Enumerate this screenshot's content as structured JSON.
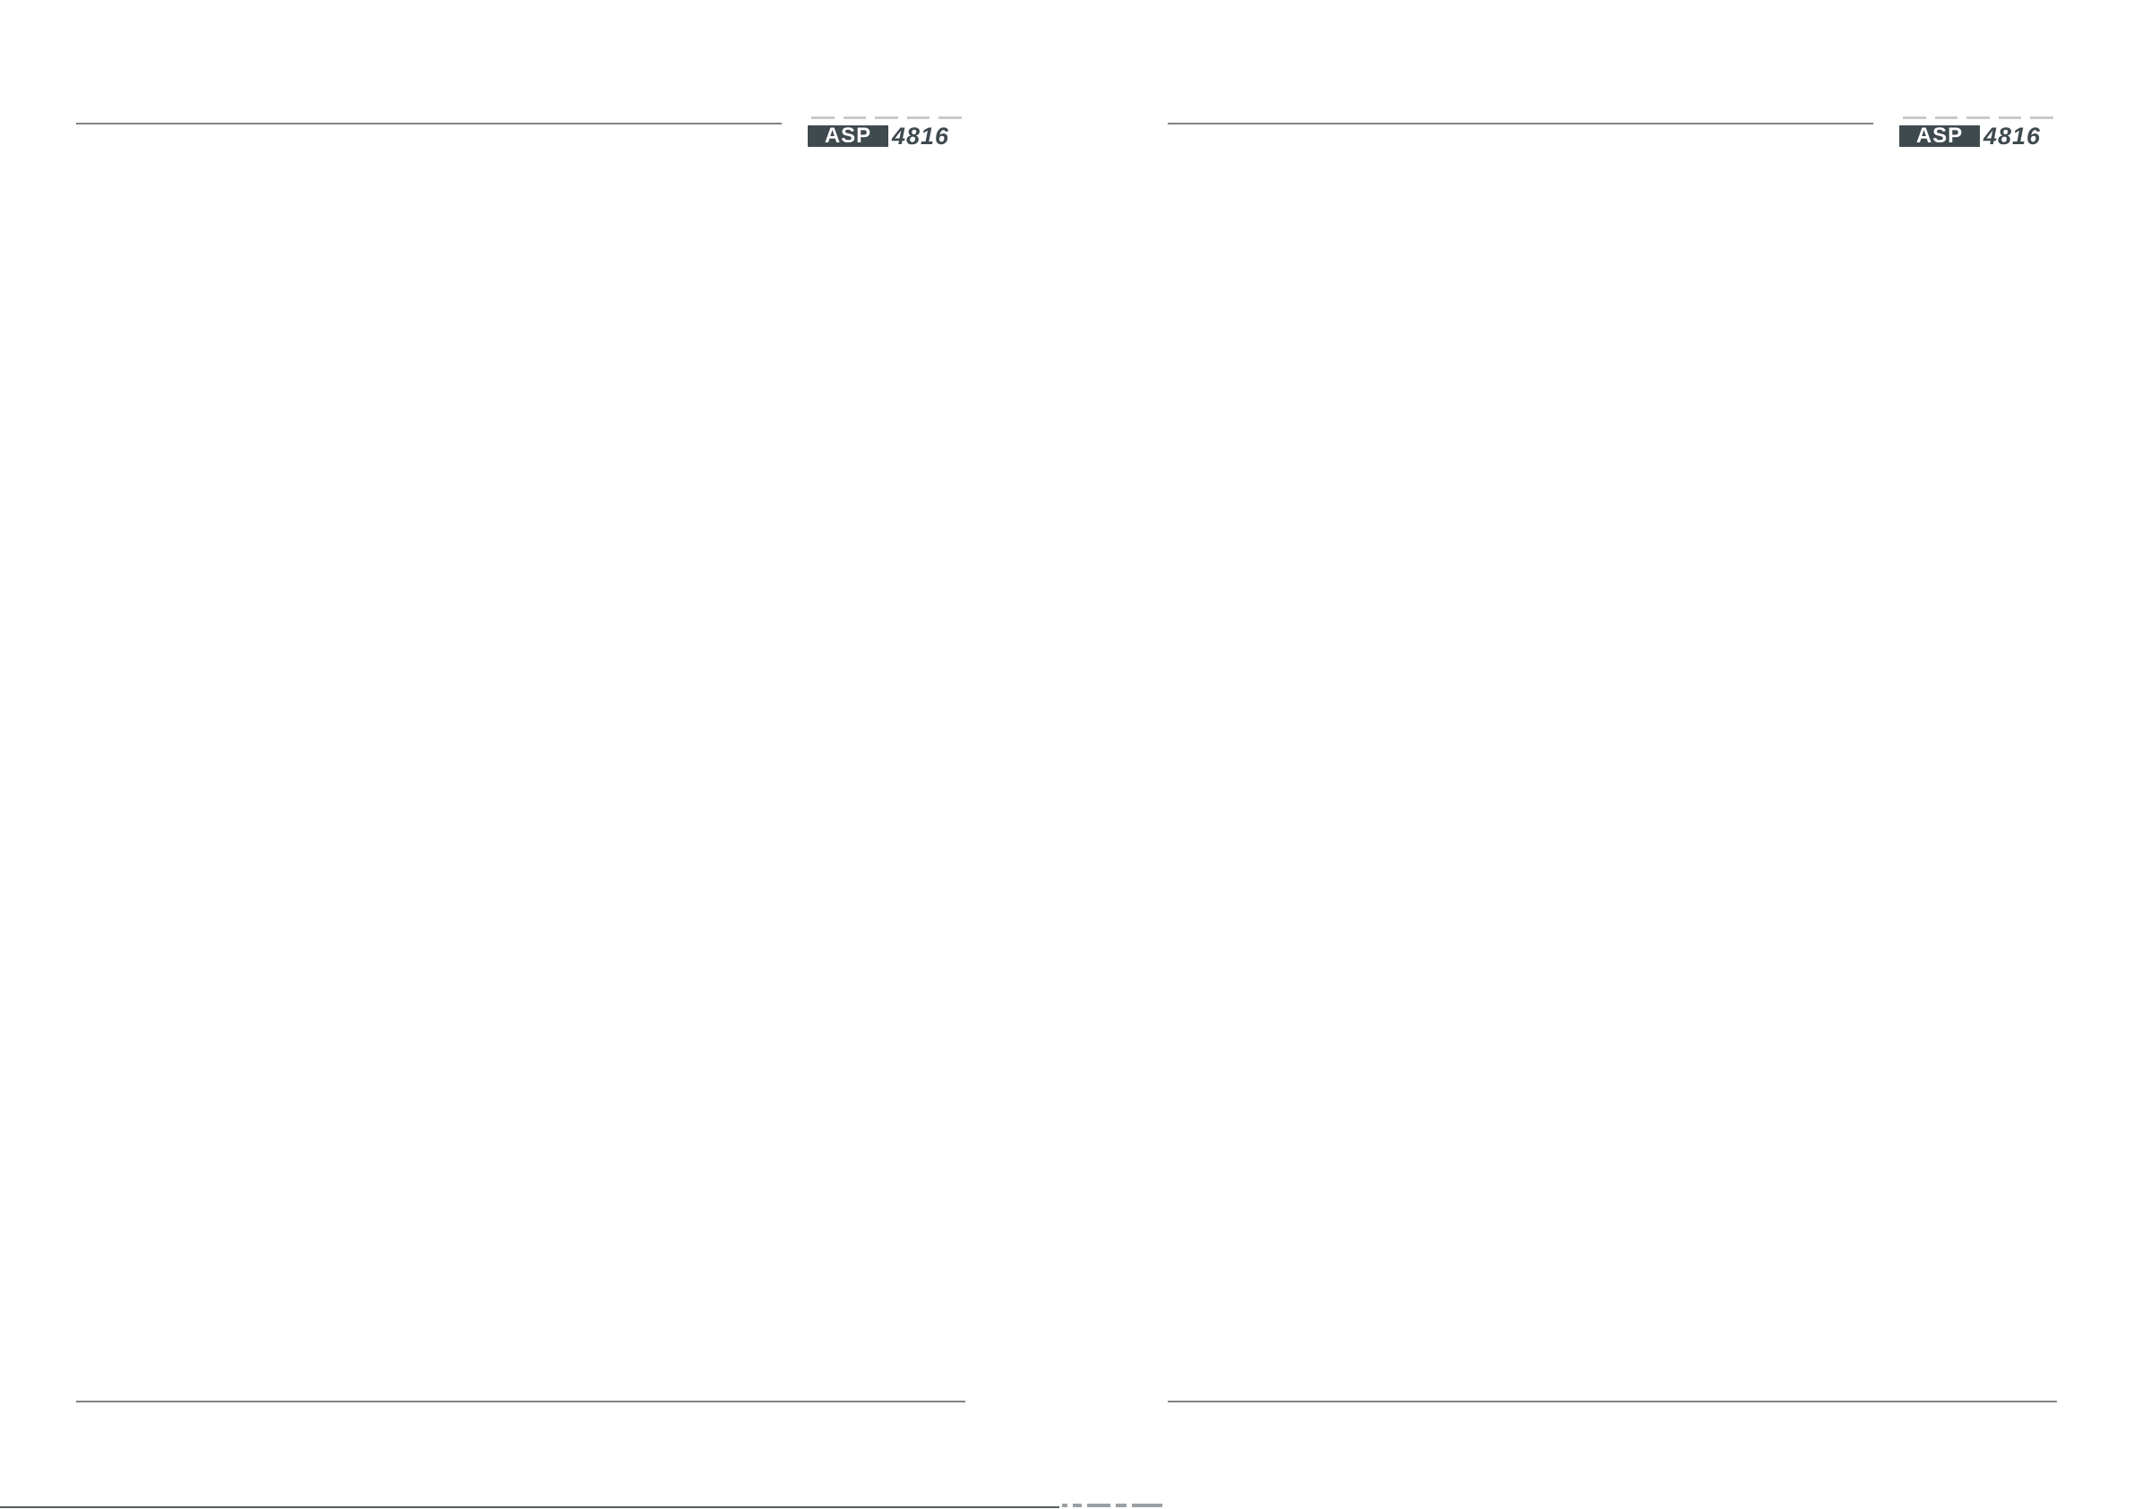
{
  "spread": {
    "pages": [
      {
        "id": "left",
        "logo": {
          "box_text": "ASP",
          "number_text": "4816"
        }
      },
      {
        "id": "right",
        "logo": {
          "box_text": "ASP",
          "number_text": "4816"
        }
      }
    ]
  },
  "colors": {
    "rule": "#7d8487",
    "logo_dark": "#3f4a4f",
    "logo_light": "#c6cacc",
    "background": "#ffffff"
  }
}
